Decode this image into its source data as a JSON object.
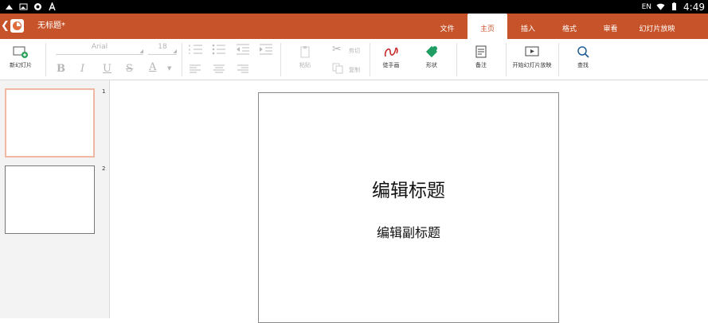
{
  "status_bar": {
    "lang": "EN",
    "time": "4:49"
  },
  "titlebar": {
    "doc_title": "无标题*"
  },
  "tabs": [
    {
      "label": "文件",
      "active": false
    },
    {
      "label": "主页",
      "active": true
    },
    {
      "label": "插入",
      "active": false
    },
    {
      "label": "格式",
      "active": false
    },
    {
      "label": "审看",
      "active": false
    },
    {
      "label": "幻灯片放映",
      "active": false
    }
  ],
  "toolbar": {
    "new_slide": "新幻灯片",
    "font_name": "Arial",
    "font_size": "18",
    "bold": "B",
    "italic": "I",
    "underline": "U",
    "strike": "S",
    "font_color": "A",
    "paste": "粘贴",
    "cut": "剪切",
    "copy": "复制",
    "freehand": "徒手画",
    "shapes": "形状",
    "notes": "备注",
    "start_show": "开始幻灯片放映",
    "find": "查找"
  },
  "thumbnails": [
    {
      "number": "1"
    },
    {
      "number": "2"
    }
  ],
  "slide": {
    "title": "编辑标题",
    "subtitle": "编辑副标题"
  },
  "colors": {
    "accent": "#c7532a",
    "selected_thumb_border": "#f0b7a3"
  }
}
